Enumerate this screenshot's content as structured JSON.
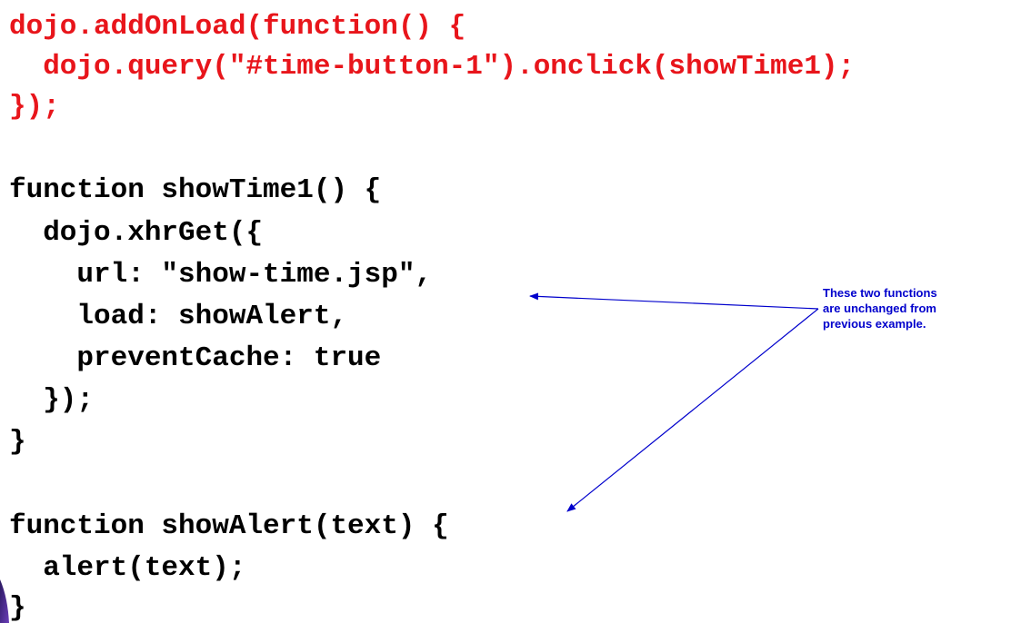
{
  "code": {
    "lines": [
      "dojo.addOnLoad(function() {",
      "  dojo.query(\"#time-button-1\").onclick(showTime1);",
      "});",
      "",
      "function showTime1() {",
      "  dojo.xhrGet({",
      "    url: \"show-time.jsp\",",
      "    load: showAlert,",
      "    preventCache: true",
      "  });",
      "}",
      "",
      "function showAlert(text) {",
      "  alert(text);",
      "}"
    ],
    "highlight_color": "#e8151b",
    "text_color": "#000000"
  },
  "annotation": {
    "text": "These two functions are unchanged from previous example.",
    "color": "#0000cc"
  },
  "decoration": {
    "corner_color": "#4b2a8c"
  }
}
